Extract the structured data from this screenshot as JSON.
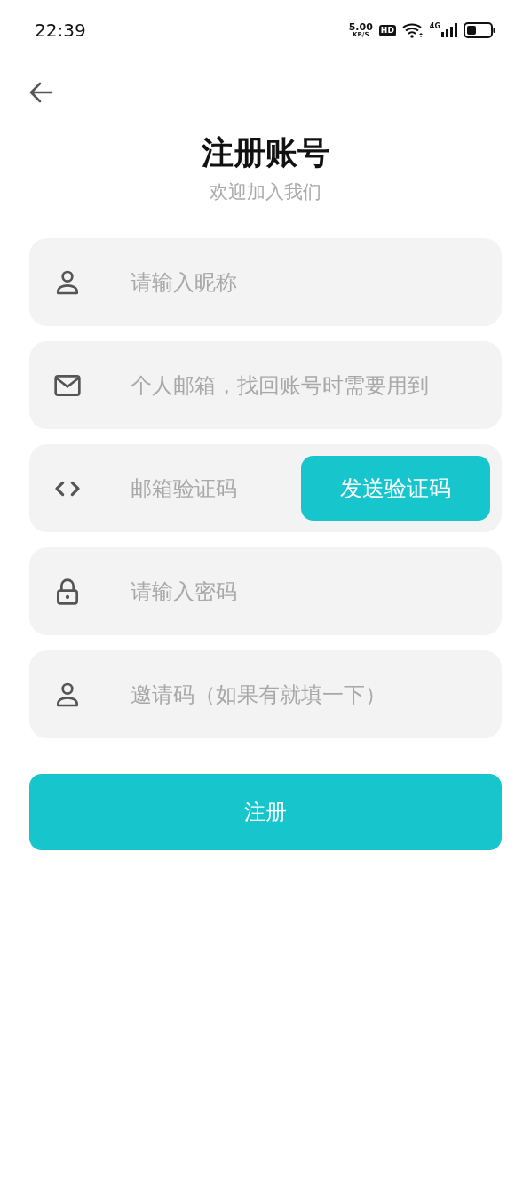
{
  "status_bar": {
    "time": "22:39",
    "speed_value": "5.00",
    "speed_unit": "KB/S",
    "hd_label": "HD",
    "network_label": "4G"
  },
  "title": "注册账号",
  "subtitle": "欢迎加入我们",
  "fields": [
    {
      "kind": "person",
      "placeholder": "请输入昵称"
    },
    {
      "kind": "mail",
      "placeholder": "个人邮箱，找回账号时需要用到"
    },
    {
      "kind": "code",
      "placeholder": "邮箱验证码",
      "button": "发送验证码"
    },
    {
      "kind": "lock",
      "placeholder": "请输入密码"
    },
    {
      "kind": "person",
      "placeholder": "邀请码（如果有就填一下）"
    }
  ],
  "submit": "注册"
}
